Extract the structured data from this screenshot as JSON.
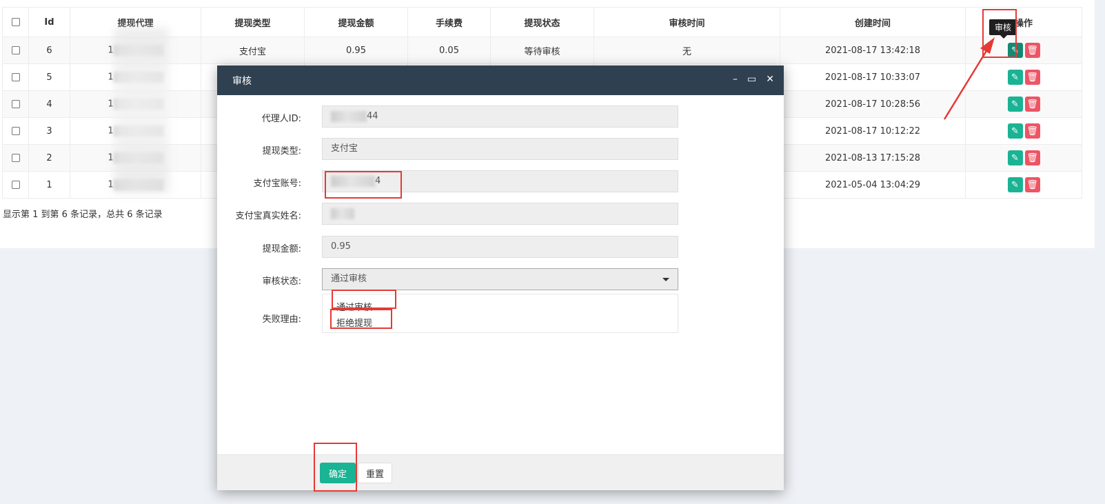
{
  "table": {
    "headers": [
      "",
      "Id",
      "提现代理",
      "提现类型",
      "提现金额",
      "手续费",
      "提现状态",
      "审核时间",
      "创建时间",
      "操作"
    ],
    "rows": [
      {
        "id": "6",
        "agent_prefix": "1",
        "type": "支付宝",
        "amount": "0.95",
        "fee": "0.05",
        "status": "等待审核",
        "audit_time": "无",
        "created": "2021-08-17 13:42:18"
      },
      {
        "id": "5",
        "agent_prefix": "1",
        "type": "",
        "amount": "",
        "fee": "",
        "status": "",
        "audit_time": "",
        "created": "2021-08-17 10:33:07"
      },
      {
        "id": "4",
        "agent_prefix": "1",
        "type": "",
        "amount": "",
        "fee": "",
        "status": "",
        "audit_time": "",
        "created": "2021-08-17 10:28:56"
      },
      {
        "id": "3",
        "agent_prefix": "1",
        "type": "",
        "amount": "",
        "fee": "",
        "status": "",
        "audit_time": "",
        "created": "2021-08-17 10:12:22"
      },
      {
        "id": "2",
        "agent_prefix": "1",
        "type": "",
        "amount": "",
        "fee": "",
        "status": "",
        "audit_time": "",
        "created": "2021-08-13 17:15:28"
      },
      {
        "id": "1",
        "agent_prefix": "1",
        "type": "",
        "amount": "",
        "fee": "",
        "status": "",
        "audit_time": "",
        "created": "2021-05-04 13:04:29"
      }
    ],
    "footer": "显示第 1 到第 6 条记录，总共 6 条记录"
  },
  "tooltip": "审核",
  "modal": {
    "title": "审核",
    "fields": {
      "agent_id_label": "代理人ID:",
      "agent_id_value": "44",
      "type_label": "提现类型:",
      "type_value": "支付宝",
      "account_label": "支付宝账号:",
      "account_value": "4",
      "realname_label": "支付宝真实姓名:",
      "realname_value": "",
      "amount_label": "提现金额:",
      "amount_value": "0.95",
      "status_label": "审核状态:",
      "status_value": "通过审核",
      "reason_label": "失败理由:"
    },
    "options": [
      "通过审核",
      "拒绝提现"
    ],
    "confirm_label": "确定",
    "reset_label": "重置"
  },
  "colors": {
    "primary": "#1ab394",
    "danger": "#ed5565",
    "header": "#2f4050",
    "highlight": "#e53935"
  },
  "icons": {
    "edit": "pencil-icon",
    "delete": "trash-icon",
    "minimize": "minimize-icon",
    "maximize": "maximize-icon",
    "close": "close-icon",
    "caret": "caret-down-icon"
  }
}
